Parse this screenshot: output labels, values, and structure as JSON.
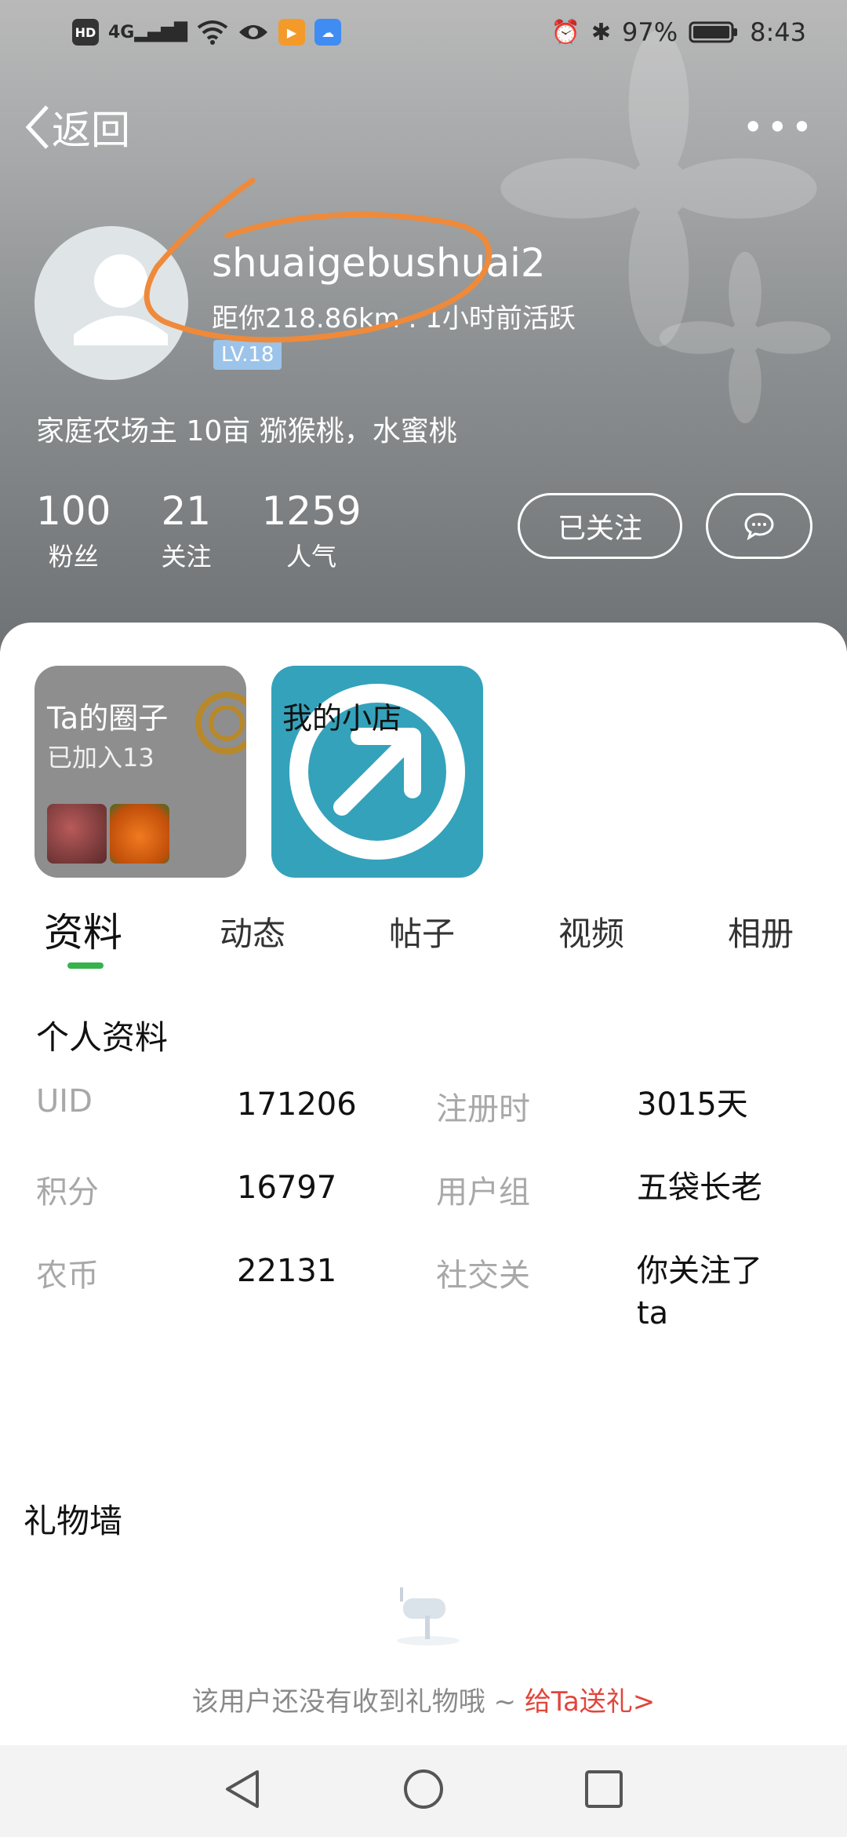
{
  "status_bar": {
    "left_icons": [
      "hd-icon",
      "signal-4g-icon",
      "wifi-icon",
      "eye-icon",
      "video-app-icon",
      "cloud-app-icon"
    ],
    "network": "4G",
    "hd": "HD",
    "battery": "97%",
    "time": "8:43"
  },
  "nav": {
    "back_label": "返回",
    "more_label": "•••"
  },
  "profile": {
    "username": "shuaigebushuai2",
    "distance_activity": "距你218.86km . 1小时前活跃",
    "level": "LV.18",
    "bio": "家庭农场主 10亩 猕猴桃，水蜜桃"
  },
  "stats": [
    {
      "value": "100",
      "label": "粉丝"
    },
    {
      "value": "21",
      "label": "关注"
    },
    {
      "value": "1259",
      "label": "人气"
    }
  ],
  "actions": {
    "follow_label": "已关注",
    "chat_label": "···"
  },
  "tiles": {
    "circle_title": "Ta的圈子",
    "circle_sub": "已加入13",
    "shop_title": "我的小店"
  },
  "tabs": [
    "资料",
    "动态",
    "帖子",
    "视频",
    "相册"
  ],
  "profile_section": {
    "title": "个人资料",
    "rows": [
      {
        "k1": "UID",
        "v1": "171206",
        "k2": "注册时",
        "v2": "3015天"
      },
      {
        "k1": "积分",
        "v1": "16797",
        "k2": "用户组",
        "v2": "五袋长老"
      },
      {
        "k1": "农币",
        "v1": "22131",
        "k2": "社交关",
        "v2": "你关注了ta"
      }
    ]
  },
  "gift_wall": {
    "title": "礼物墙",
    "empty_text": "该用户还没有收到礼物哦 ~ ",
    "link_text": "给Ta送礼>"
  },
  "colors": {
    "accent_green": "#37b24d",
    "level_badge": "#9cc4ea",
    "gift_link": "#e2453c",
    "shop_tile": "#34a2bb",
    "annotation": "#ef8a3a"
  }
}
